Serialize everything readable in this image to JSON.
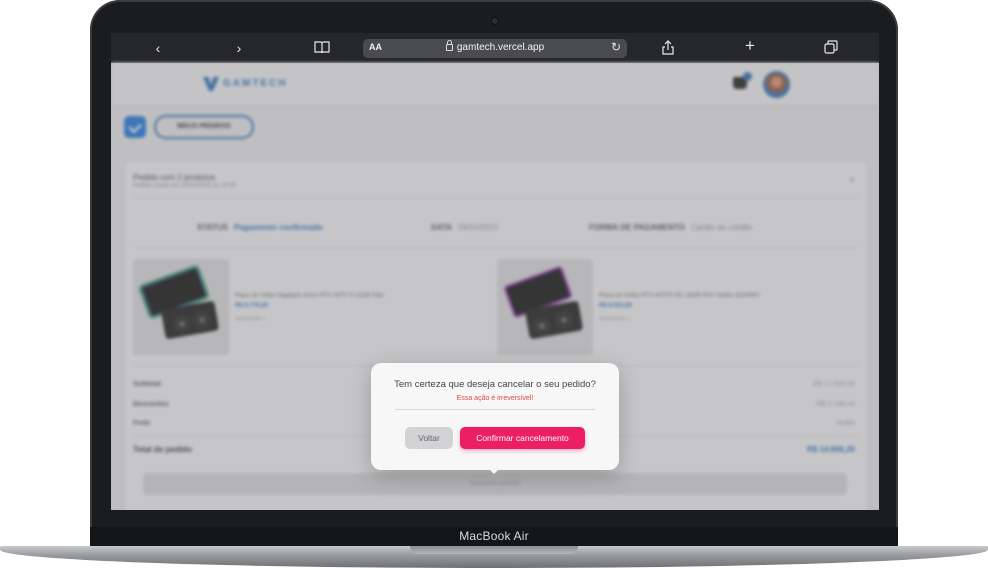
{
  "device": {
    "brand_label": "MacBook Air"
  },
  "browser": {
    "url": "gamtech.vercel.app",
    "text_size_label": "AA",
    "icons": [
      "back-icon",
      "forward-icon",
      "book-icon",
      "lock-icon",
      "reload-icon",
      "share-icon",
      "new-tab-icon",
      "tabs-icon"
    ],
    "toolbar_color": "#26272a"
  },
  "site": {
    "logo_text": "GAMTECH",
    "brand_color": "#2d6fb5",
    "my_orders_label": "MEUS PEDIDOS",
    "order": {
      "title": "Pedido com 2 produtos",
      "subtitle": "Pedido criado em 29/10/2023 às 15:00",
      "status_label": "STATUS",
      "status_value": "Pagamento confirmado",
      "date_label": "DATA",
      "date_value": "29/10/2023",
      "payment_label": "FORMA DE PAGAMENTO",
      "payment_value": "Cartão de crédito",
      "products": [
        {
          "name": "Placa de Vídeo Gigabyte Aorus RTX 4070 Ti 12GB Elite",
          "price": "R$ 6.779,28",
          "qty": "Quantidade: 1"
        },
        {
          "name": "Placa de Vídeo RTX 4070Ti OC 16GB PNY Nvidia GDDR6X",
          "price": "R$ 8.024,29",
          "qty": "Quantidade: 1"
        }
      ],
      "summary": [
        {
          "label": "Subtotal",
          "value": "R$ 17.000,00"
        },
        {
          "label": "Descontos",
          "value": "-R$ 2.194,43"
        },
        {
          "label": "Frete",
          "value": "Grátis"
        }
      ],
      "total_label": "Total do pedido",
      "total_value": "R$ 14.806,20",
      "cancel_label": "Cancelar pedido"
    }
  },
  "modal": {
    "question": "Tem certeza que deseja cancelar o seu pedido?",
    "warning": "Essa ação é irreversível!",
    "back_label": "Voltar",
    "confirm_label": "Confirmar cancelamento",
    "confirm_color": "#ec1e64",
    "warning_color": "#e04646"
  }
}
